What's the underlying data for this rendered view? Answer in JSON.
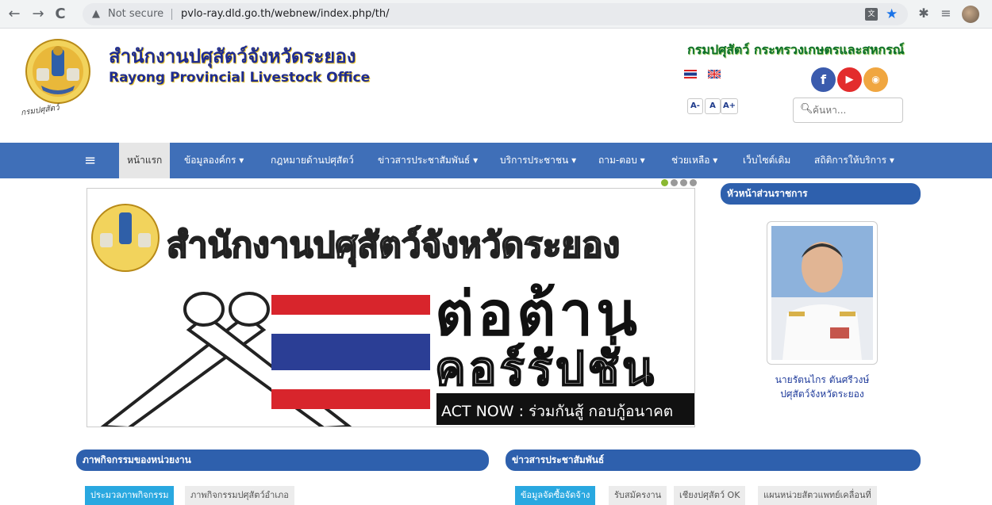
{
  "browser": {
    "back": "←",
    "forward": "→",
    "reload": "C",
    "security_label": "Not secure",
    "url": "pvlo-ray.dld.go.th/webnew/index.php/th/"
  },
  "header": {
    "title_th": "สำนักงานปศุสัตว์จังหวัดระยอง",
    "title_en": "Rayong Provincial Livestock Office",
    "ministry": "กรมปศุสัตว์  กระทรวงเกษตรและสหกรณ์",
    "logo_caption": "กรมปศุสัตว์",
    "font_small": "A-",
    "font_normal": "A",
    "font_large": "A+",
    "search_placeholder": "ค้นหา..."
  },
  "nav": {
    "items": [
      {
        "label": "หน้าแรก"
      },
      {
        "label": "ข้อมูลองค์กร ▾"
      },
      {
        "label": "กฎหมายด้านปศุสัตว์"
      },
      {
        "label": "ข่าวสารประชาสัมพันธ์ ▾"
      },
      {
        "label": "บริการประชาชน ▾"
      },
      {
        "label": "ถาม-ตอบ ▾"
      },
      {
        "label": "ช่วยเหลือ ▾"
      },
      {
        "label": "เว็บไซต์เดิม"
      },
      {
        "label": "สถิติการให้บริการ ▾"
      }
    ]
  },
  "slider": {
    "headline": "สำนักงานปศุสัตว์จังหวัดระยอง",
    "big_line1": "ต่อต้าน",
    "big_line2": "คอร์รัปชั่น",
    "banner": "ACT NOW : ร่วมกันสู้ กอบกู้อนาคต",
    "slide_count": 4,
    "active_slide": 1
  },
  "sidebar": {
    "header": "หัวหน้าส่วนราชการ",
    "director_name": "นายรัตนไกร ตันศรีวงษ์",
    "director_title": "ปศุสัตว์จังหวัดระยอง"
  },
  "activities": {
    "header": "ภาพกิจกรรมของหน่วยงาน",
    "tabs": [
      "ประมวลภาพกิจกรรม",
      "ภาพกิจกรรมปศุสัตว์อำเภอ"
    ]
  },
  "news": {
    "header": "ข่าวสารประชาสัมพันธ์",
    "tabs": [
      "ข้อมูลจัดซื้อจัดจ้าง",
      "รับสมัครงาน",
      "เชียงปศุสัตว์ OK",
      "แผนหน่วยสัตวแพทย์เคลื่อนที่"
    ]
  },
  "colors": {
    "nav_bg": "#3f6fb8",
    "panel_header": "#2e60ad",
    "tab_active": "#29a8e0",
    "title_blue": "#1f2c8f",
    "ministry_green": "#0c6f2b"
  }
}
